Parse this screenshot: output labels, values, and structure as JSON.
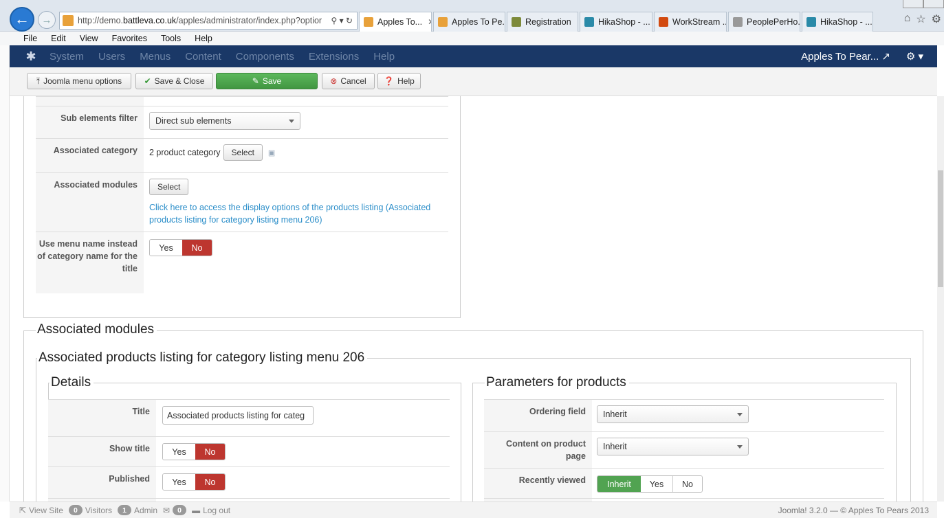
{
  "browser": {
    "url_prefix": "http://demo.",
    "url_domain": "battleva.co.uk",
    "url_rest": "/apples/administrator/index.php?optior",
    "url_tools": "⚲ ▾ ↻",
    "tabs": [
      {
        "label": "Apples To...",
        "active": true,
        "color": "#e8a13a"
      },
      {
        "label": "Apples To Pe...",
        "active": false,
        "color": "#e8a13a"
      },
      {
        "label": "Registration",
        "active": false,
        "color": "#7d8a3a"
      },
      {
        "label": "HikaShop - ...",
        "active": false,
        "color": "#2a8aa8"
      },
      {
        "label": "WorkStream ...",
        "active": false,
        "color": "#d24a10"
      },
      {
        "label": "PeoplePerHo...",
        "active": false,
        "color": "#999999"
      },
      {
        "label": "HikaShop - ...",
        "active": false,
        "color": "#2a8aa8"
      }
    ],
    "menu": [
      "File",
      "Edit",
      "View",
      "Favorites",
      "Tools",
      "Help"
    ]
  },
  "joomla_nav": {
    "items": [
      "System",
      "Users",
      "Menus",
      "Content",
      "Components",
      "Extensions",
      "Help"
    ],
    "site_name": "Apples To Pear...",
    "site_link_icon": "↗",
    "gear_label": "⚙ ▾"
  },
  "toolbar": {
    "menu_options": "Joomla menu options",
    "save_close": "Save & Close",
    "save": "Save",
    "cancel": "Cancel",
    "help": "Help"
  },
  "upper_form": {
    "sub_elements_filter": {
      "label": "Sub elements filter",
      "value": "Direct sub elements"
    },
    "associated_category": {
      "label": "Associated category",
      "value": "2 product category",
      "button": "Select"
    },
    "associated_modules": {
      "label": "Associated modules",
      "button": "Select",
      "link": "Click here to access the display options of the products listing (Associated products listing for category listing menu 206)"
    },
    "use_menu_name": {
      "label": "Use menu name instead of category name for the title",
      "yes": "Yes",
      "no": "No",
      "selected": "No"
    }
  },
  "associated_modules_section": {
    "legend": "Associated modules",
    "module_legend": "Associated products listing for category listing menu 206",
    "details": {
      "legend": "Details",
      "title": {
        "label": "Title",
        "value": "Associated products listing for categ"
      },
      "show_title": {
        "label": "Show title",
        "yes": "Yes",
        "no": "No",
        "selected": "No"
      },
      "published": {
        "label": "Published",
        "yes": "Yes",
        "no": "No",
        "selected": "No"
      }
    },
    "parameters": {
      "legend": "Parameters for products",
      "ordering_field": {
        "label": "Ordering field",
        "value": "Inherit"
      },
      "content_on_product_page": {
        "label": "Content on product page",
        "value": "Inherit"
      },
      "recently_viewed": {
        "label": "Recently viewed",
        "inherit": "Inherit",
        "yes": "Yes",
        "no": "No",
        "selected": "Inherit"
      }
    }
  },
  "status_bar": {
    "view_site": "View Site",
    "visitors_count": "0",
    "visitors": "Visitors",
    "admin_count": "1",
    "admin": "Admin",
    "messages_count": "0",
    "logout": "Log out",
    "copyright": "Joomla! 3.2.0  —  © Apples To Pears 2013"
  }
}
